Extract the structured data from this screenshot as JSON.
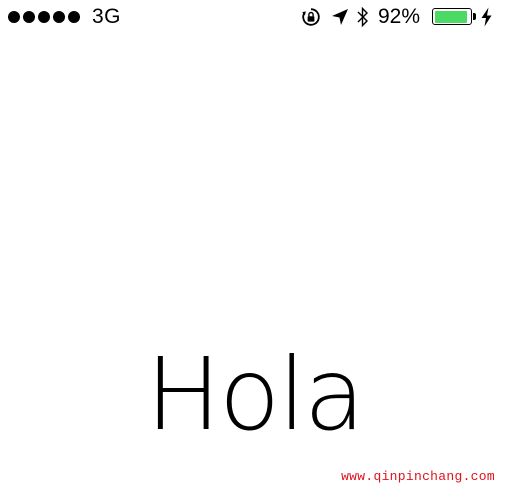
{
  "status_bar": {
    "carrier": "3G",
    "signal_strength": 5,
    "battery_percent": "92%",
    "battery_level": 0.92,
    "icons": {
      "rotation_lock": "rotation-lock-icon",
      "location": "location-arrow-icon",
      "bluetooth": "bluetooth-icon",
      "battery": "battery-icon",
      "charging": "charging-bolt-icon"
    }
  },
  "main": {
    "greeting": "Hola"
  },
  "watermark": {
    "text": "www.qinpinchang.com"
  },
  "colors": {
    "battery_fill": "#4cd964",
    "watermark": "#e1121b",
    "background": "#ffffff",
    "text": "#000000"
  }
}
